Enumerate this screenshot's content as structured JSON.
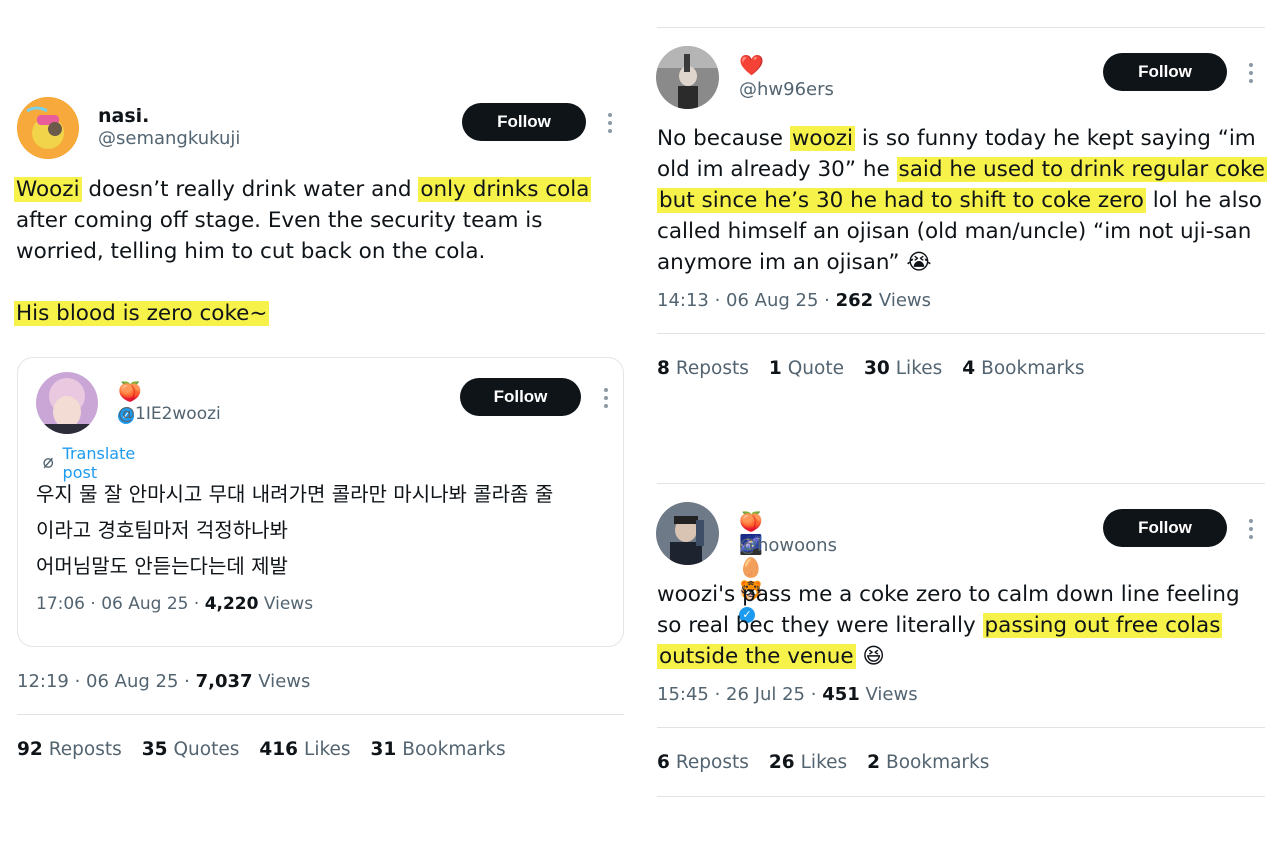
{
  "left": {
    "name": "nasi.",
    "handle": "@semangkukuji",
    "follow": "Follow",
    "text": {
      "l1_hl1": "Woozi",
      "l1_mid": " doesn’t really drink water and ",
      "l1_hl2": "only drinks cola",
      "l2": "after coming off stage. Even the security team is",
      "l3": "worried, telling him to cut back on the cola.",
      "l4_hl": "His blood is zero coke~"
    },
    "quote": {
      "emojis": "🍑",
      "handle": "@1IE2woozi",
      "follow": "Follow",
      "translate": "Translate post",
      "lines": [
        "우지 물 잘 안마시고 무대 내려가면 콜라만 마시나봐 콜라좀 줄",
        "이라고 경호팀마저 걱정하나봐",
        "어머님말도 안듣는다는데 제발"
      ],
      "time": "17:06 · 06 Aug 25 · ",
      "views_num": "4,220",
      "views_label": " Views"
    },
    "time": "12:19 · 06 Aug 25 · ",
    "views_num": "7,037",
    "views_label": " Views",
    "stats": {
      "reposts_num": "92",
      "reposts": "Reposts",
      "quotes_num": "35",
      "quotes": "Quotes",
      "likes_num": "416",
      "likes": "Likes",
      "bookmarks_num": "31",
      "bookmarks": "Bookmarks"
    }
  },
  "right_top": {
    "emoji": "❤️",
    "handle": "@hw96ers",
    "follow": "Follow",
    "text": {
      "l1_a": "No because ",
      "l1_hl": "woozi",
      "l1_b": " is so funny today he kept saying “im",
      "l2_a": "old im already 30” he ",
      "l2_hl": "said he used to drink regular coke",
      "l3_hl": "but since he’s 30 he had to shift to coke zero",
      "l3_b": " lol he also",
      "l4": "called himself an ojisan (old man/uncle) “im not uji-san",
      "l5": "anymore im an ojisan” 😭"
    },
    "time": "14:13 · 06 Aug 25 · ",
    "views_num": "262",
    "views_label": " Views",
    "stats": {
      "reposts_num": "8",
      "reposts": "Reposts",
      "quote_num": "1",
      "quote": "Quote",
      "likes_num": "30",
      "likes": "Likes",
      "bookmarks_num": "4",
      "bookmarks": "Bookmarks"
    }
  },
  "right_bottom": {
    "emojis": "🍑🌌🥚🐯",
    "handle": "@howoons",
    "follow": "Follow",
    "text": {
      "l1": "woozi's pass me a coke zero to calm down line feeling",
      "l2_a": "so real bec they were literally ",
      "l2_hl": "passing out free colas",
      "l3_hl": "outside the venue",
      "l3_b": " 😆"
    },
    "time": "15:45 · 26 Jul 25 · ",
    "views_num": "451",
    "views_label": " Views",
    "stats": {
      "reposts_num": "6",
      "reposts": "Reposts",
      "likes_num": "26",
      "likes": "Likes",
      "bookmarks_num": "2",
      "bookmarks": "Bookmarks"
    }
  },
  "colors": {
    "highlight": "#f7f24a",
    "verified": "#1d9bf0",
    "button": "#0f1419"
  }
}
